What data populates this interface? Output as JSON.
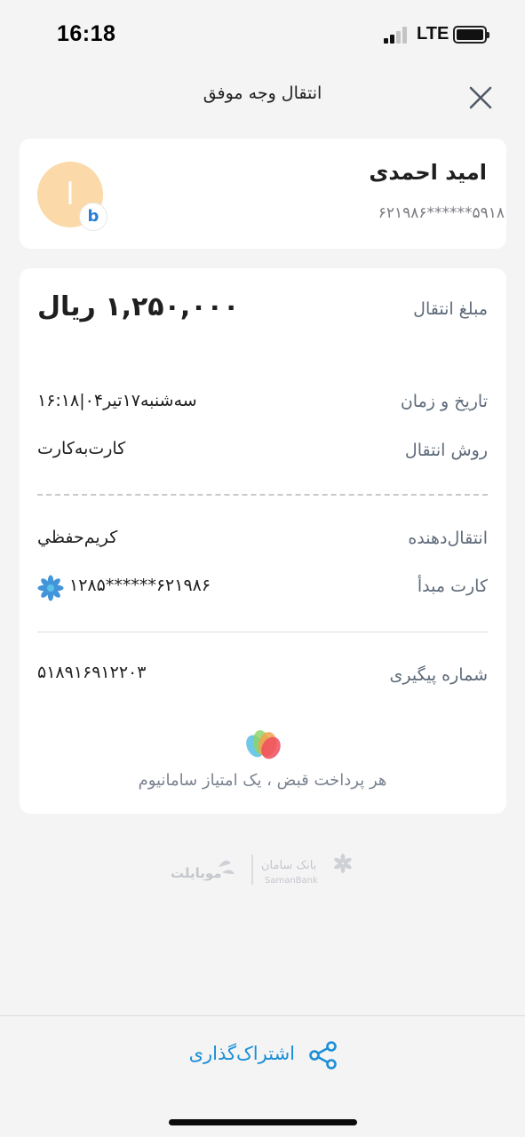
{
  "status_bar": {
    "time": "16:18",
    "network": "LTE"
  },
  "header": {
    "title": "انتقال وجه موفق",
    "close_icon": "close-icon"
  },
  "recipient": {
    "name": "امید احمدی",
    "card_number": "۶۲۱۹۸۶******۵۹۱۸",
    "avatar_initial": "ا",
    "bank_badge_letter": "b"
  },
  "details": {
    "amount_label": "مبلغ انتقال",
    "amount_value": "۱,۲۵۰,۰۰۰ ریال",
    "datetime_label": "تاریخ و زمان",
    "datetime_value": "سه‌شنبه۱۷تیر۰۴|۱۶:۱۸",
    "method_label": "روش انتقال",
    "method_value": "کارت‌به‌کارت",
    "sender_label": "انتقال‌دهنده",
    "sender_value": "كريم‌حفظي",
    "source_card_label": "کارت مبدأ",
    "source_card_value": "۶۲۱۹۸۶******۱۲۸۵",
    "tracking_label": "شماره پیگیری",
    "tracking_value": "۵۱۸۹۱۶۹۱۲۲۰۳"
  },
  "promo": {
    "text": "هر پرداخت قبض ، یک امتیاز سامانیوم"
  },
  "footer_logos": {
    "mobilet": "موبایلت",
    "bank_fa": "بانک سامان",
    "bank_en": "SamanBank"
  },
  "share": {
    "label": "اشتراک‌گذاری"
  },
  "colors": {
    "accent": "#1a8fd6",
    "avatar_bg": "#fbd9a8",
    "background": "#f4f4f5"
  }
}
